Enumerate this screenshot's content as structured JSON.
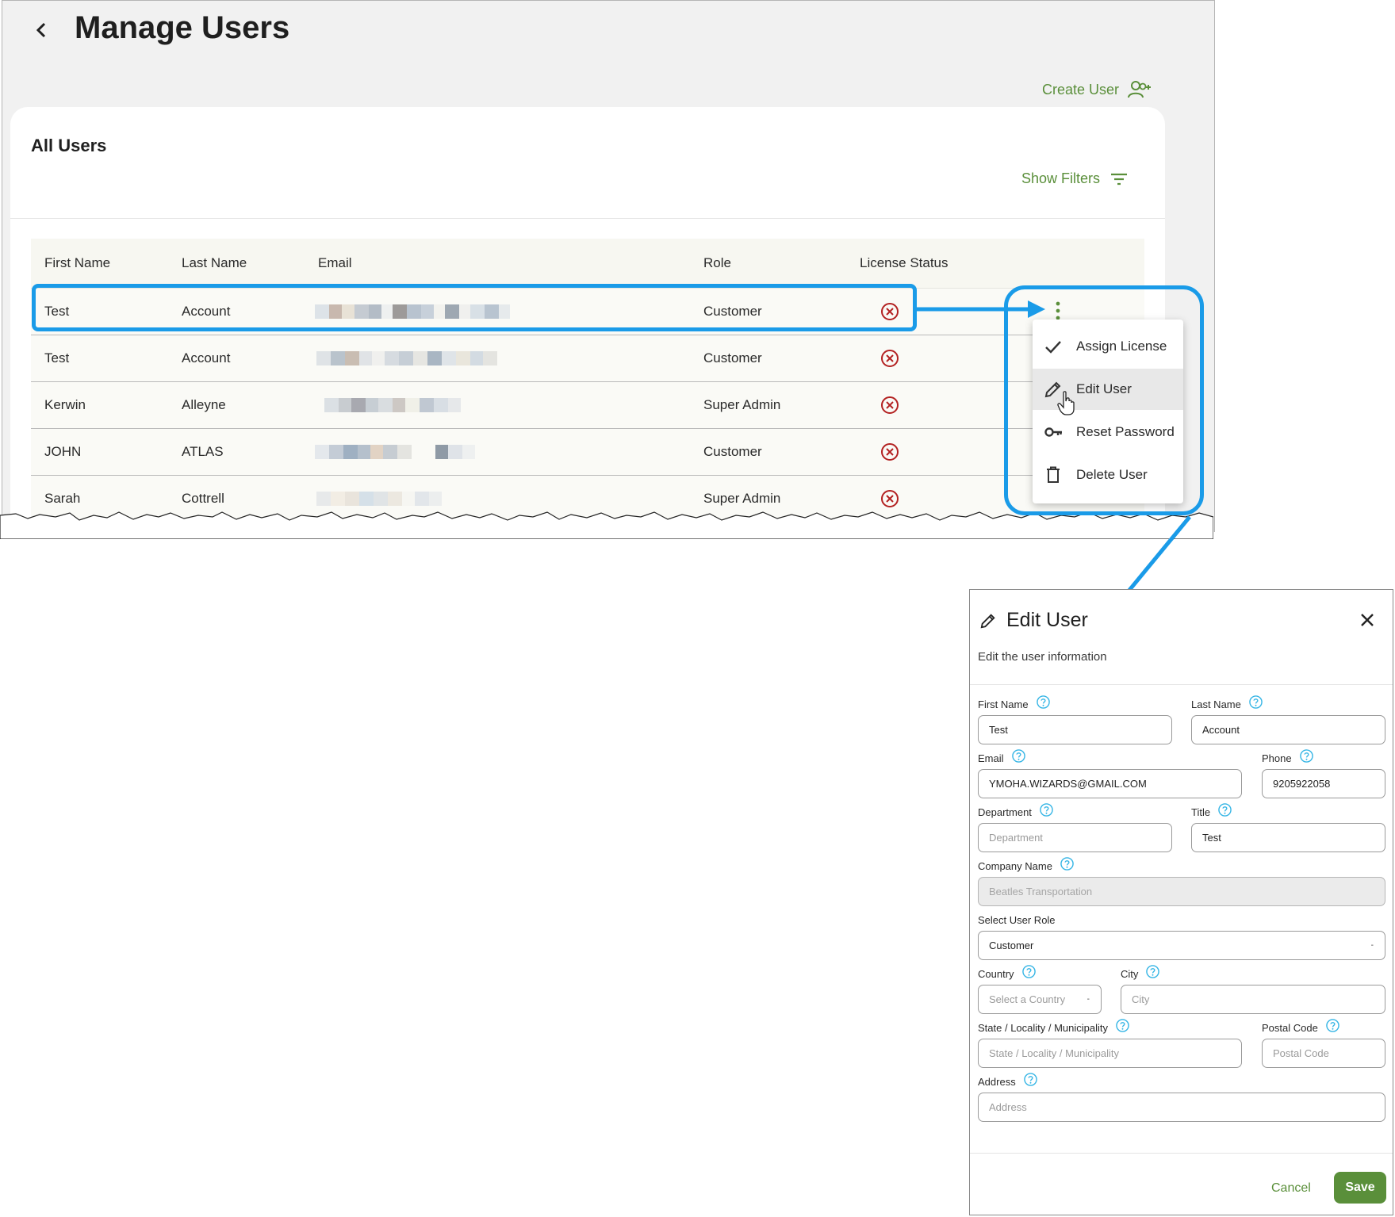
{
  "page": {
    "title": "Manage Users",
    "create_user_label": "Create User"
  },
  "card": {
    "title": "All Users",
    "show_filters_label": "Show Filters"
  },
  "table": {
    "columns": [
      "First Name",
      "Last Name",
      "Email",
      "Role",
      "License Status"
    ],
    "rows": [
      {
        "first": "Test",
        "last": "Account",
        "role": "Customer"
      },
      {
        "first": "Test",
        "last": "Account",
        "role": "Customer"
      },
      {
        "first": "Kerwin",
        "last": "Alleyne",
        "role": "Super Admin"
      },
      {
        "first": "JOHN",
        "last": "ATLAS",
        "role": "Customer"
      },
      {
        "first": "Sarah",
        "last": "Cottrell",
        "role": "Super Admin"
      }
    ]
  },
  "menu": {
    "items": [
      {
        "label": "Assign License",
        "icon": "check-icon"
      },
      {
        "label": "Edit User",
        "icon": "pencil-icon"
      },
      {
        "label": "Reset Password",
        "icon": "key-icon"
      },
      {
        "label": "Delete User",
        "icon": "trash-icon"
      }
    ]
  },
  "dialog": {
    "title": "Edit User",
    "subtitle": "Edit the user information",
    "fields": {
      "first_name": {
        "label": "First Name",
        "value": "Test"
      },
      "last_name": {
        "label": "Last Name",
        "value": "Account"
      },
      "email": {
        "label": "Email",
        "value": "YMOHA.WIZARDS@GMAIL.COM"
      },
      "phone": {
        "label": "Phone",
        "value": "9205922058"
      },
      "department": {
        "label": "Department",
        "placeholder": "Department"
      },
      "title": {
        "label": "Title",
        "value": "Test"
      },
      "company": {
        "label": "Company Name",
        "value": "Beatles Transportation"
      },
      "role": {
        "label": "Select User Role",
        "value": "Customer"
      },
      "country": {
        "label": "Country",
        "placeholder": "Select a Country"
      },
      "city": {
        "label": "City",
        "placeholder": "City"
      },
      "state": {
        "label": "State / Locality / Municipality",
        "placeholder": "State / Locality / Municipality"
      },
      "postal": {
        "label": "Postal Code",
        "placeholder": "Postal Code"
      },
      "address": {
        "label": "Address",
        "placeholder": "Address"
      }
    },
    "cancel_label": "Cancel",
    "save_label": "Save"
  },
  "colors": {
    "accent": "#5a8f3a",
    "highlight": "#1a9be8",
    "error": "#b32121",
    "help": "#35b5e5"
  }
}
